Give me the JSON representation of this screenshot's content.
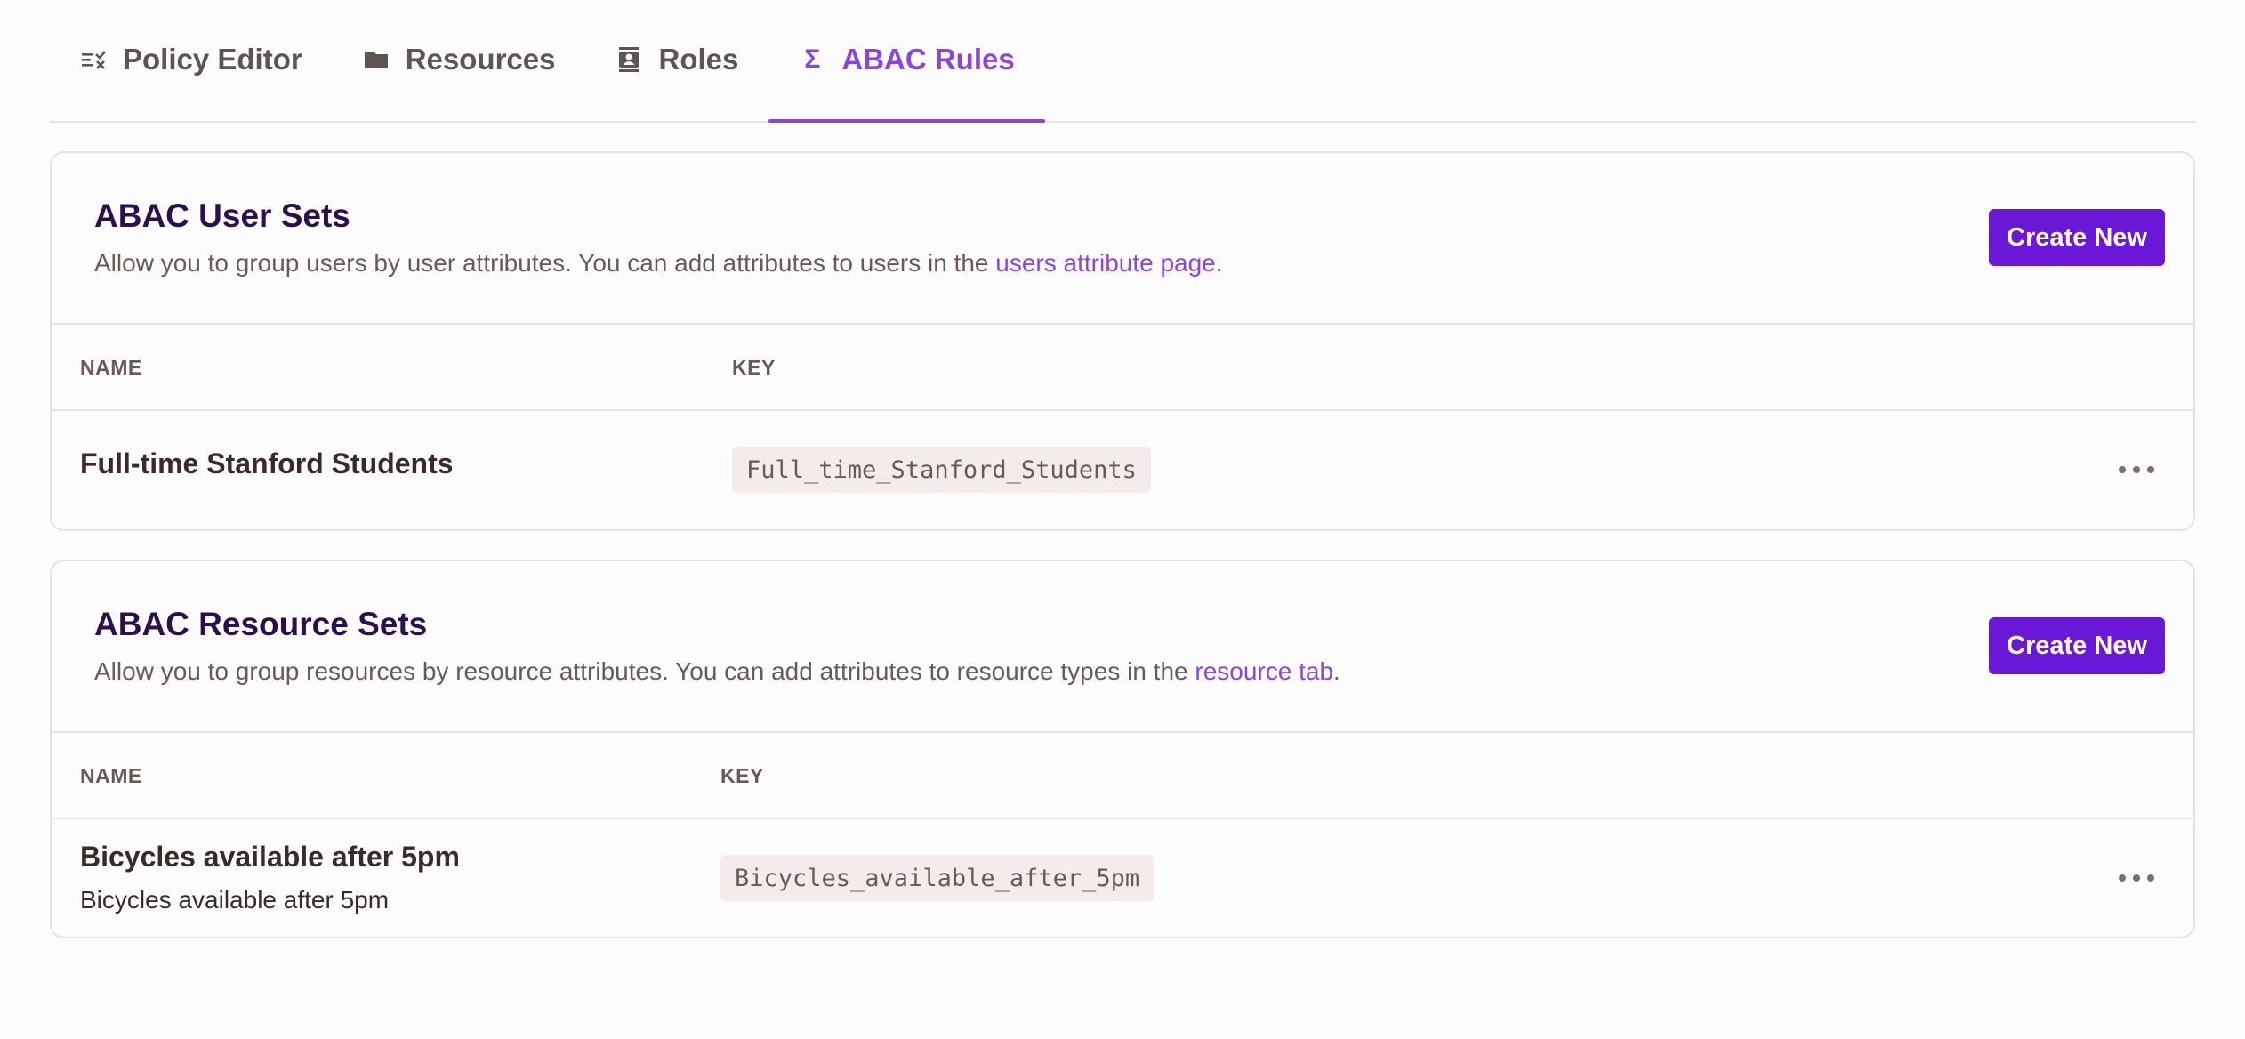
{
  "tabs": [
    {
      "label": "Policy Editor",
      "icon": "policy-list-icon"
    },
    {
      "label": "Resources",
      "icon": "folder-icon"
    },
    {
      "label": "Roles",
      "icon": "contact-book-icon"
    },
    {
      "label": "ABAC Rules",
      "icon": "sigma-icon",
      "active": true
    }
  ],
  "user_sets": {
    "title": "ABAC User Sets",
    "desc_prefix": "Allow you to group users by user attributes. You can add attributes to users in the ",
    "desc_link": "users attribute page",
    "desc_suffix": ".",
    "button": "Create New",
    "columns": {
      "name": "NAME",
      "key": "KEY"
    },
    "rows": [
      {
        "name": "Full-time Stanford Students",
        "key": "Full_time_Stanford_Students"
      }
    ]
  },
  "resource_sets": {
    "title": "ABAC Resource Sets",
    "desc_prefix": "Allow you to group resources by resource attributes. You can add attributes to resource types in the ",
    "desc_link": "resource tab",
    "desc_suffix": ".",
    "button": "Create New",
    "columns": {
      "name": "NAME",
      "key": "KEY"
    },
    "rows": [
      {
        "name": "Bicycles available after 5pm",
        "description": "Bicycles available after 5pm",
        "key": "Bicycles_available_after_5pm"
      }
    ]
  },
  "colors": {
    "accent": "#8d44dd",
    "button": "#6a17d8",
    "title": "#2c0f4e"
  }
}
